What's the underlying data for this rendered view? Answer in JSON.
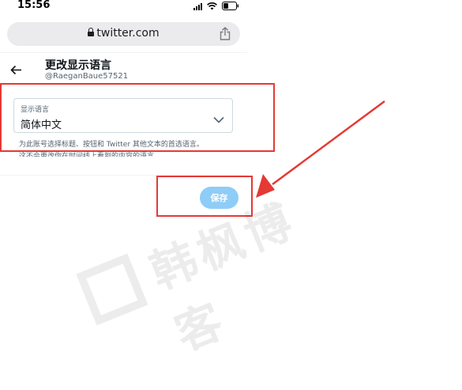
{
  "status_bar": {
    "time": "15:56"
  },
  "browser": {
    "url": "twitter.com"
  },
  "header": {
    "title": "更改显示语言",
    "handle": "@RaeganBaue57521"
  },
  "language_select": {
    "label": "显示语言",
    "value": "简体中文"
  },
  "help": {
    "line1": "为此账号选择标题、按钮和 Twitter 其他文本的首选语言。",
    "line2": "这不会更改你在时间线上看到的内容的语言。"
  },
  "actions": {
    "save_label": "保存"
  },
  "watermark": {
    "text": "韩枫博客"
  },
  "colors": {
    "annotation_red": "#e53935",
    "save_button_disabled": "#8ecdf8"
  }
}
